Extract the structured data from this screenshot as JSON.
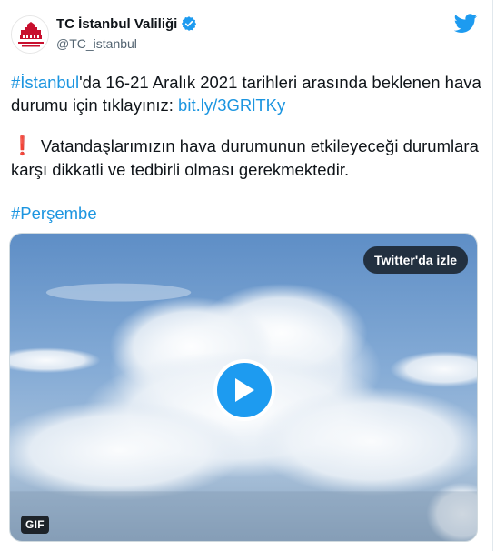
{
  "account": {
    "name": "TC İstanbul Valiliği",
    "handle": "@TC_istanbul"
  },
  "icons": {
    "avatar": "istanbul-governorship-logo",
    "verified": "verified-badge-icon",
    "brand": "twitter-bird-icon",
    "play": "play-icon"
  },
  "tweet": {
    "hashtag_city": "#İstanbul",
    "line1_rest": "'da 16-21 Aralık 2021 tarihleri arasında beklenen hava durumu için tıklayınız: ",
    "link": "bit.ly/3GRlTKy",
    "alert_mark": "❗",
    "warning": "Vatandaşlarımızın hava durumunun etkileyeceği durumlara karşı dikkatli ve tedbirli olması gerekmektedir.",
    "hashtag_day": "#Perşembe"
  },
  "media": {
    "watch_label": "Twitter'da izle",
    "badge": "GIF"
  },
  "colors": {
    "link": "#1b95e0",
    "verified": "#1d9bf0",
    "twitter": "#1d9bf0",
    "alert": "#e0245e"
  }
}
